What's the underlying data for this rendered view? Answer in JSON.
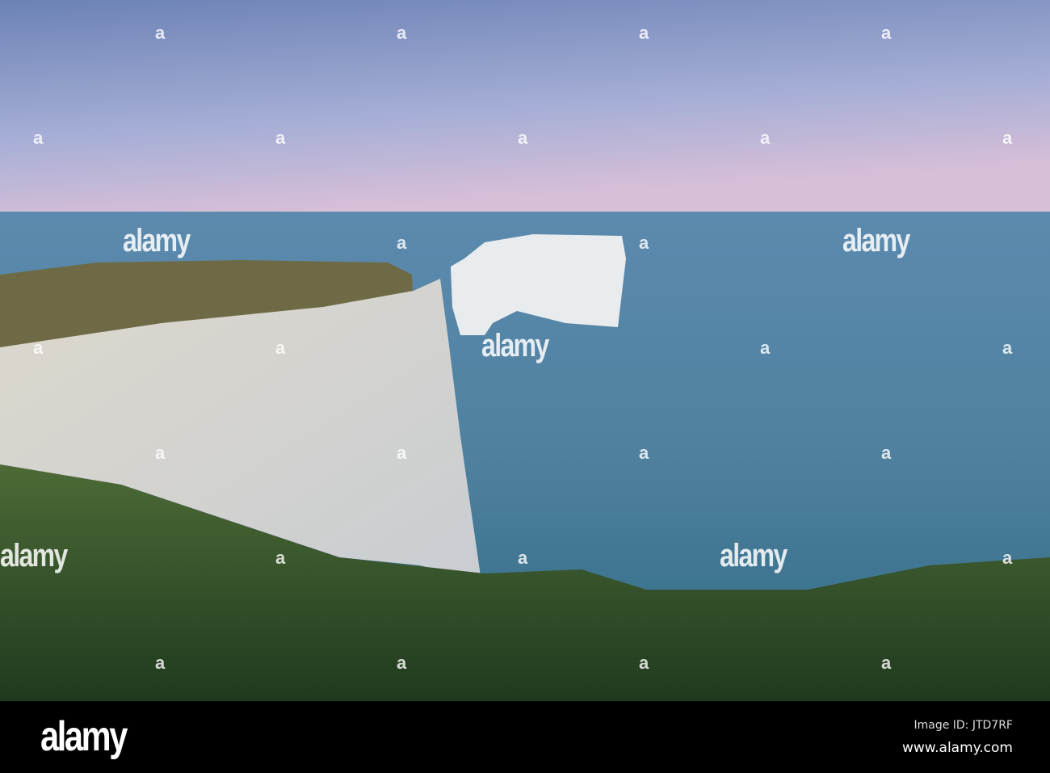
{
  "photo": {
    "subject": "Chalk cliffs and sea stack at dusk"
  },
  "watermark": {
    "text": "alamy",
    "mark": "a"
  },
  "footer": {
    "logo": "alamy",
    "image_id": "Image ID: JTD7RF",
    "website": "www.alamy.com"
  },
  "colors": {
    "sky_top": "#6f86b8",
    "sky_pink": "#d9bcd6",
    "sea": "#4f7f9c",
    "grass": "#3d5a2c",
    "chalk": "#e6e4df"
  }
}
